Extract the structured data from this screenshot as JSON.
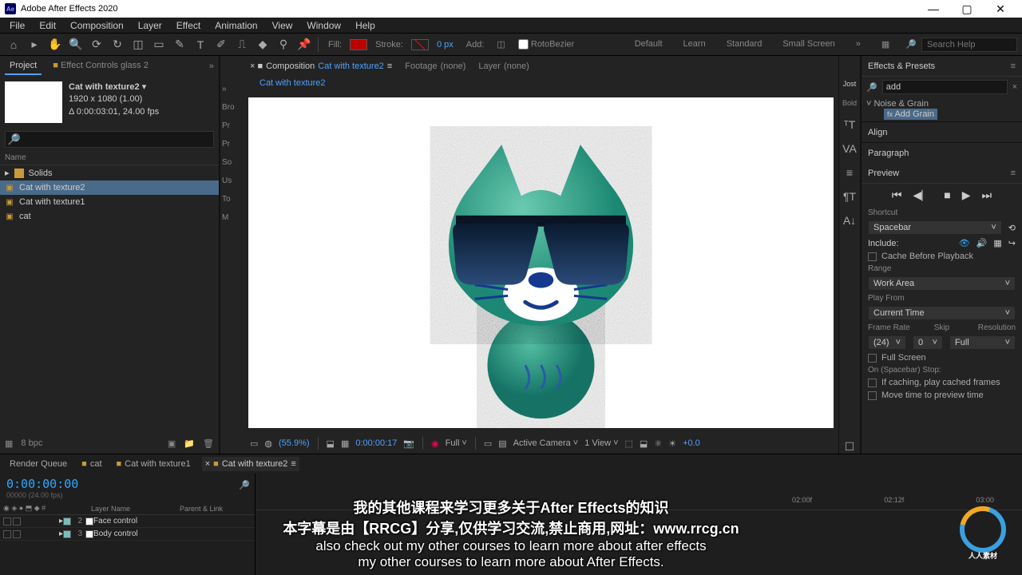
{
  "title": "Adobe After Effects 2020",
  "menubar": [
    "File",
    "Edit",
    "Composition",
    "Layer",
    "Effect",
    "Animation",
    "View",
    "Window",
    "Help"
  ],
  "toolbar": {
    "fill_label": "Fill:",
    "stroke_label": "Stroke:",
    "stroke_px": "0 px",
    "add_label": "Add:",
    "rotobezier": "RotoBezier",
    "search_ph": "Search Help"
  },
  "workspaces": [
    "Default",
    "Learn",
    "Standard",
    "Small Screen"
  ],
  "project": {
    "tab_project": "Project",
    "tab_effect_controls": "Effect Controls glass 2",
    "name": "Cat with texture2",
    "dims": "1920 x 1080 (1.00)",
    "dur": "Δ 0:00:03:01, 24.00 fps",
    "search_ph": "",
    "head_name": "Name",
    "items": [
      {
        "type": "folder",
        "name": "Solids"
      },
      {
        "type": "comp",
        "name": "Cat with texture2",
        "selected": true
      },
      {
        "type": "comp",
        "name": "Cat with texture1"
      },
      {
        "type": "comp",
        "name": "cat"
      }
    ],
    "bpc": "8 bpc"
  },
  "hidden_panel_hints": [
    "»",
    "Bro",
    "Pr",
    "Pr",
    "So",
    "Us",
    "To",
    "",
    "M"
  ],
  "composition": {
    "tabs": [
      {
        "icon": "×",
        "prefix": "■",
        "label": "Composition",
        "target": "Cat with texture2",
        "active": true
      },
      {
        "label": "Footage",
        "target": "(none)"
      },
      {
        "label": "Layer",
        "target": "(none)"
      }
    ],
    "crumb": "Cat with texture2",
    "footer": {
      "zoom": "(55.9%)",
      "time": "0:00:00:17",
      "res": "Full",
      "camera": "Active Camera",
      "views": "1 View",
      "exposure": "+0.0"
    }
  },
  "right_panels": {
    "effects_presets": "Effects & Presets",
    "eff_search": "add",
    "eff_cat": "Noise & Grain",
    "eff_item": "Add Grain",
    "align": "Align",
    "paragraph": "Paragraph",
    "preview": "Preview",
    "shortcut_lbl": "Shortcut",
    "shortcut_val": "Spacebar",
    "include_lbl": "Include:",
    "cache_before": "Cache Before Playback",
    "range_lbl": "Range",
    "range_val": "Work Area",
    "playfrom_lbl": "Play From",
    "playfrom_val": "Current Time",
    "framerate_lbl": "Frame Rate",
    "skip_lbl": "Skip",
    "resolution_lbl": "Resolution",
    "framerate_val": "(24)",
    "skip_val": "0",
    "resolution_val": "Full",
    "fullscreen": "Full Screen",
    "onstop_lbl": "On (Spacebar) Stop:",
    "onstop1": "If caching, play cached frames",
    "onstop2": "Move time to preview time"
  },
  "char_hint": "Jost",
  "char_hint2": "Bold",
  "timeline": {
    "tabs": [
      {
        "label": "Render Queue"
      },
      {
        "label": "cat",
        "icon": "■"
      },
      {
        "label": "Cat with texture1",
        "icon": "■"
      },
      {
        "label": "Cat with texture2",
        "icon": "■",
        "active": true
      }
    ],
    "timecode": "0:00:00:00",
    "frames": "00000 (24.00 fps)",
    "head_layer": "Layer Name",
    "head_parent": "Parent & Link",
    "layers": [
      {
        "idx": 2,
        "name": "Face control"
      },
      {
        "idx": 3,
        "name": "Body control"
      }
    ],
    "ticks": [
      "02:00f",
      "02:12f",
      "03:00"
    ]
  },
  "subtitles": {
    "cn1": "我的其他课程来学习更多关于After Effects的知识",
    "cn2": "本字幕是由【RRCG】分享,仅供学习交流,禁止商用,网址：www.rrcg.cn",
    "en1": "also check out my other courses to learn more about after effects",
    "en2": "my other courses to learn more about After Effects."
  },
  "watermark": "人人素材 RRCG"
}
